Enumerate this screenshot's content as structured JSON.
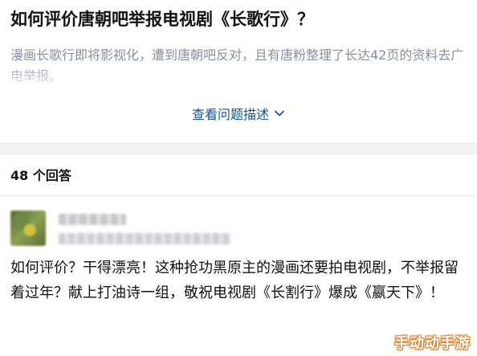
{
  "question": {
    "title": "如何评价唐朝吧举报电视剧《长歌行》？",
    "detail": "漫画长歌行即将影视化，遭到唐朝吧反对，且有唐粉整理了长达42页的资料去广电举报。",
    "expand_label": "查看问题描述"
  },
  "answers": {
    "count_label": "48 个回答"
  },
  "answer": {
    "text": "如何评价？干得漂亮！这种抢功黑原主的漫画还要拍电视剧，不举报留着过年？献上打油诗一组，敬祝电视剧《长割行》爆成《嬴天下》！"
  },
  "watermark": {
    "text": "手动动手游"
  },
  "colors": {
    "link_blue": "#175199",
    "muted_text": "#8590a6",
    "divider": "#f3f3f5"
  }
}
